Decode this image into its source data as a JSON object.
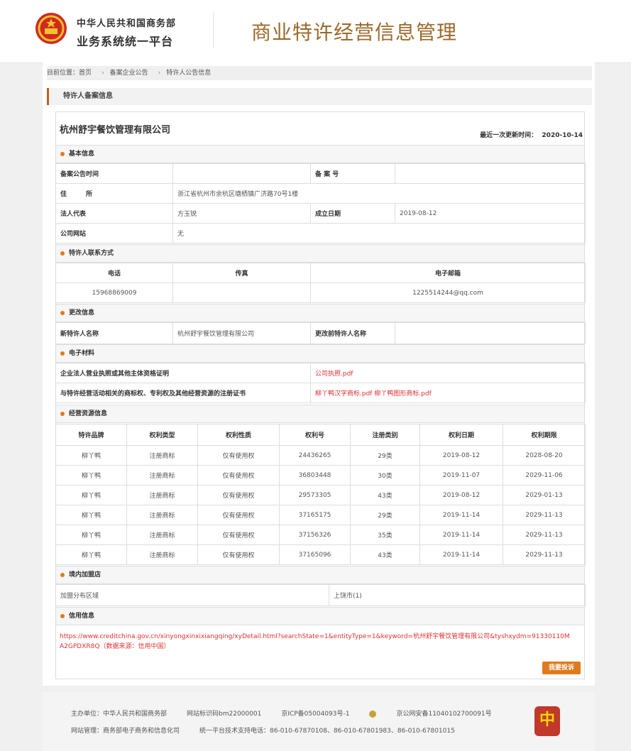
{
  "header": {
    "org_line1": "中华人民共和国商务部",
    "org_line2": "业务系统统一平台",
    "title": "商业特许经营信息管理"
  },
  "breadcrumb": {
    "prefix": "目前位置：",
    "items": [
      "首页",
      "备案企业公告",
      "特许人公告信息"
    ]
  },
  "section_title": "特许人备案信息",
  "company": {
    "name": "杭州舒宇餐饮管理有限公司",
    "updated_label": "最近一次更新时间：",
    "updated_value": "2020-10-14"
  },
  "basic": {
    "heading": "基本信息",
    "filing_time_label": "备案公告时间",
    "filing_time_value": "",
    "filing_no_label": "备 案 号",
    "filing_no_value": "",
    "address_label": "住　　　所",
    "address_value": "浙江省杭州市余杭区塘栖镇广济路70号1楼",
    "legal_rep_label": "法人代表",
    "legal_rep_value": "方玉锐",
    "established_label": "成立日期",
    "established_value": "2019-08-12",
    "website_label": "公司网站",
    "website_value": "无"
  },
  "contact": {
    "heading": "特许人联系方式",
    "phone_label": "电话",
    "fax_label": "传真",
    "email_label": "电子邮箱",
    "phone_value": "15968869009",
    "fax_value": "",
    "email_value": "1225514244@qq.com"
  },
  "change": {
    "heading": "更改信息",
    "new_name_label": "新特许人名称",
    "new_name_value": "杭州舒宇餐饮管理有限公司",
    "old_name_label": "更改前特许人名称",
    "old_name_value": ""
  },
  "materials": {
    "heading": "电子材料",
    "license_label": "企业法人营业执照或其他主体资格证明",
    "license_value": "公司执照.pdf",
    "ip_label": "与特许经营活动相关的商标权、专利权及其他经营资源的注册证书",
    "ip_value": "柳丫鸭汉字商标.pdf 柳丫鸭图形商标.pdf"
  },
  "resources": {
    "heading": "经营资源信息",
    "columns": [
      "特许品牌",
      "权利类型",
      "权利性质",
      "权利号",
      "注册类别",
      "权利日期",
      "权利期限"
    ],
    "rows": [
      [
        "柳丫鸭",
        "注册商标",
        "仅有使用权",
        "24436265",
        "29类",
        "2019-08-12",
        "2028-08-20"
      ],
      [
        "柳丫鸭",
        "注册商标",
        "仅有使用权",
        "36803448",
        "30类",
        "2019-11-07",
        "2029-11-06"
      ],
      [
        "柳丫鸭",
        "注册商标",
        "仅有使用权",
        "29573305",
        "43类",
        "2019-08-12",
        "2029-01-13"
      ],
      [
        "柳丫鸭",
        "注册商标",
        "仅有使用权",
        "37165175",
        "29类",
        "2019-11-14",
        "2029-11-13"
      ],
      [
        "柳丫鸭",
        "注册商标",
        "仅有使用权",
        "37156326",
        "35类",
        "2019-11-14",
        "2029-11-13"
      ],
      [
        "柳丫鸭",
        "注册商标",
        "仅有使用权",
        "37165096",
        "43类",
        "2019-11-14",
        "2029-11-13"
      ]
    ]
  },
  "domestic": {
    "heading": "境内加盟店",
    "region_label": "加盟分布区域",
    "region_value": "上饶市(1)"
  },
  "credit": {
    "heading": "信用信息",
    "link": "https://www.creditchina.gov.cn/xinyongxinxixiangqing/xyDetail.html?searchState=1&entityType=1&keyword=杭州舒宇餐饮管理有限公司&tyshxydm=91330110MA2GPDXR8Q（数据来源：信用中国）"
  },
  "report_button": "我要投诉",
  "footer": {
    "sponsor": "主办单位：中华人民共和国商务部",
    "site_id": "网站标识码bm22000001",
    "icp": "京ICP备05004093号-1",
    "police": "京公网安备11040102700091号",
    "manager": "网站管理：商务部电子商务和信息化司",
    "support": "统一平台技术支持电话：86-010-67870108、86-010-67801983、86-010-67801015",
    "logo_text": "中"
  }
}
